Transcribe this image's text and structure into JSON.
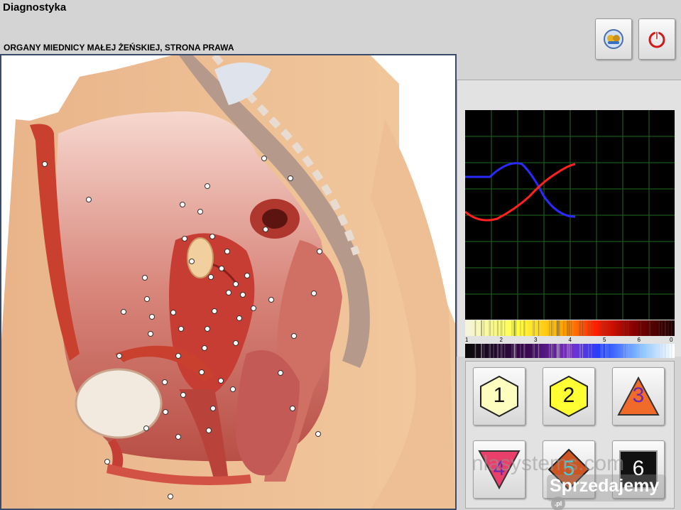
{
  "window": {
    "title": "Diagnostyka"
  },
  "section": {
    "title": "ORGANY MIEDNICY MAŁEJ ŻEŃSKIEJ, STRONA PRAWA"
  },
  "toolbar": {
    "button_a_icon": "users-icon",
    "button_b_icon": "power-icon"
  },
  "spectrum": {
    "ticks": [
      "1",
      "2",
      "3",
      "4",
      "5",
      "6",
      "0"
    ]
  },
  "grid_buttons": [
    {
      "label": "1",
      "shape": "hexagon",
      "color": "#fdfdc0"
    },
    {
      "label": "2",
      "shape": "hexagon",
      "color": "#ffff33"
    },
    {
      "label": "3",
      "shape": "triangle-up",
      "color": "#f06a2a"
    },
    {
      "label": "4",
      "shape": "triangle-down",
      "color": "#e8406a"
    },
    {
      "label": "5",
      "shape": "diamond",
      "color": "#cc5522"
    },
    {
      "label": "6",
      "shape": "square",
      "color": "#111111"
    }
  ],
  "watermarks": {
    "text_1": "nlasystems.com",
    "text_2": "Sprzedajemy",
    "text_2_suffix": ".pl"
  },
  "colors": {
    "curve_1": "#2a2aff",
    "curve_2": "#ff2020",
    "grid": "#1f6b1f"
  }
}
